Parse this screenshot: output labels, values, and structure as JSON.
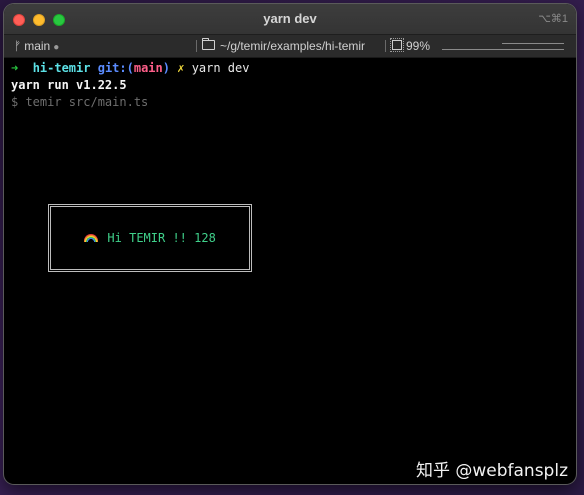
{
  "window": {
    "title": "yarn dev",
    "shortcut": "⌥⌘1"
  },
  "statusbar": {
    "branch_glyph": "ᚠ",
    "branch": "main",
    "branch_dirty": "●",
    "path": "~/g/temir/examples/hi-temir",
    "cpu": "99%"
  },
  "terminal": {
    "prompt_arrow": "➜",
    "cwd": "hi-temir",
    "git_label": "git:(",
    "git_branch": "main",
    "git_close": ")",
    "dirty_mark": "✗",
    "command": "yarn dev",
    "yarn_line": "yarn run v1.22.5",
    "run_line": "$ temir src/main.ts"
  },
  "tui": {
    "text": "Hi TEMIR !! 128",
    "emoji": "rainbow-icon"
  },
  "watermark": "知乎 @webfansplz"
}
